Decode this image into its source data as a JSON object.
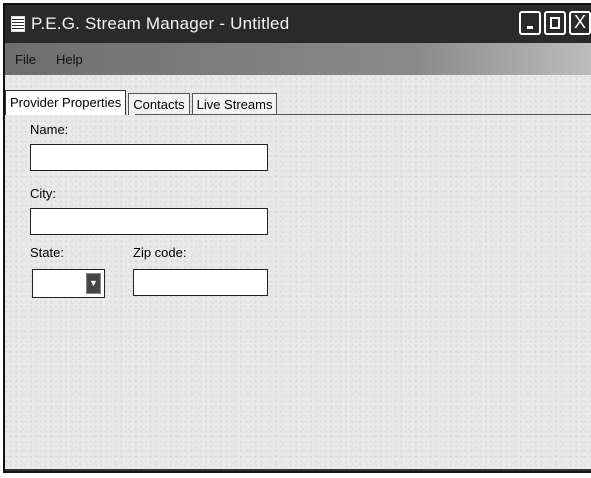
{
  "window": {
    "title": "P.E.G. Stream Manager - Untitled",
    "app_icon": "app-icon",
    "controls": {
      "minimize_icon": "minimize-icon",
      "maximize_icon": "maximize-icon",
      "close_label": "X"
    }
  },
  "menu": {
    "items": [
      {
        "label": "File"
      },
      {
        "label": "Help"
      }
    ]
  },
  "tabs": [
    {
      "label": "Provider Properties",
      "active": true
    },
    {
      "label": "Contacts",
      "active": false
    },
    {
      "label": "Live Streams",
      "active": false
    }
  ],
  "form": {
    "name": {
      "label": "Name:",
      "value": ""
    },
    "city": {
      "label": "City:",
      "value": ""
    },
    "state": {
      "label": "State:",
      "value": ""
    },
    "zip": {
      "label": "Zip code:",
      "value": ""
    }
  }
}
